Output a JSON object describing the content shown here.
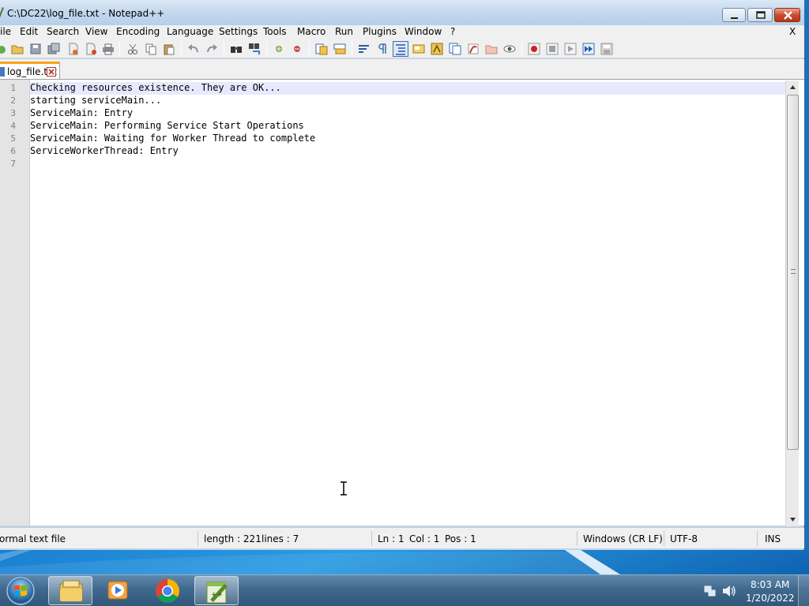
{
  "window": {
    "title": "C:\\DC22\\log_file.txt - Notepad++"
  },
  "menu": {
    "items": [
      "ile",
      "Edit",
      "Search",
      "View",
      "Encoding",
      "Language",
      "Settings",
      "Tools",
      "Macro",
      "Run",
      "Plugins",
      "Window",
      "?"
    ],
    "close_doc": "X"
  },
  "toolbar": {
    "icons": [
      "new-file-icon",
      "open-file-icon",
      "save-icon",
      "save-all-icon",
      "close-icon",
      "close-all-icon",
      "print-icon",
      "cut-icon",
      "copy-icon",
      "paste-icon",
      "undo-icon",
      "redo-icon",
      "find-icon",
      "replace-icon",
      "zoom-in-icon",
      "zoom-out-icon",
      "sync-vertical-icon",
      "sync-horizontal-icon",
      "word-wrap-icon",
      "show-all-chars-icon",
      "indent-guide-icon",
      "user-language-icon",
      "doc-map-icon",
      "function-list-icon",
      "folder-workspace-icon",
      "open-folder-icon",
      "monitoring-icon",
      "record-macro-icon",
      "stop-recording-icon",
      "play-macro-icon",
      "run-macro-multiple-icon",
      "save-macro-icon"
    ]
  },
  "tab": {
    "label": "log_file.txt"
  },
  "editor": {
    "line_numbers": [
      "1",
      "2",
      "3",
      "4",
      "5",
      "6",
      "7"
    ],
    "lines": [
      "Checking resources existence. They are OK...",
      "starting serviceMain...",
      "ServiceMain: Entry",
      "ServiceMain: Performing Service Start Operations",
      "ServiceMain: Waiting for Worker Thread to complete",
      "ServiceWorkerThread: Entry",
      ""
    ]
  },
  "status": {
    "file_type": "ormal text file",
    "length": "length : 221",
    "lines": "lines : 7",
    "ln": "Ln : 1",
    "col": "Col : 1",
    "pos": "Pos : 1",
    "eol": "Windows (CR LF)",
    "encoding": "UTF-8",
    "mode": "INS"
  },
  "taskbar": {
    "apps": [
      "windows-explorer-icon",
      "media-player-icon",
      "chrome-icon",
      "notepadpp-icon"
    ],
    "clock_time": "8:03 AM",
    "clock_date": "1/20/2022"
  },
  "colors": {
    "tab_accent": "#f9a21b",
    "current_line": "#e8e8ff",
    "close_button": "#c9452a"
  }
}
